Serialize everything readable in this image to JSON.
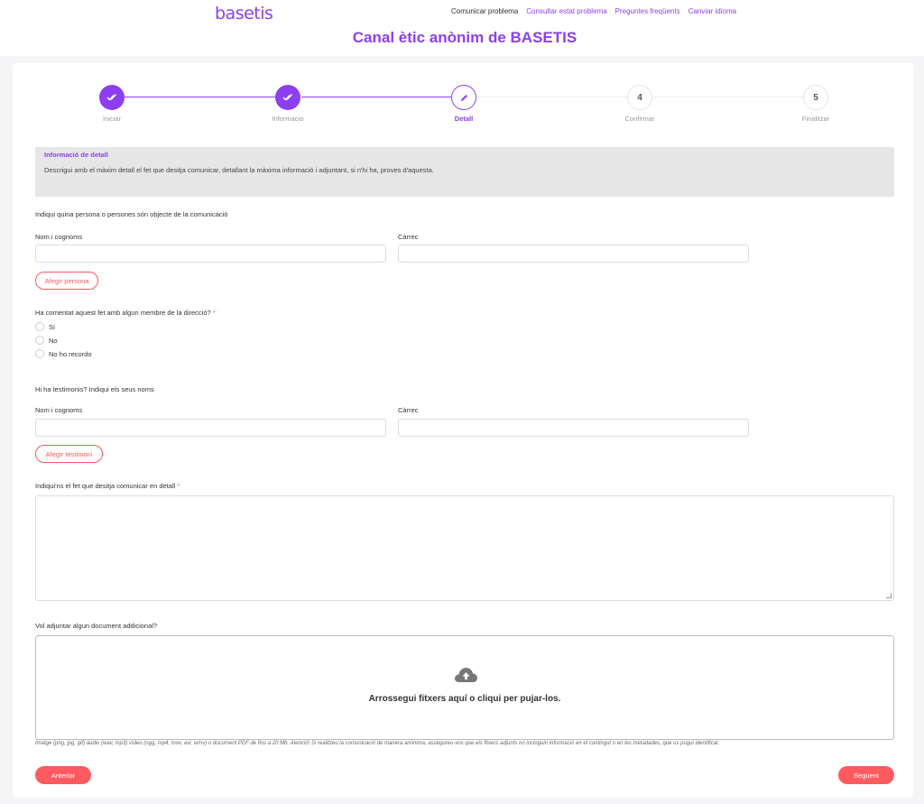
{
  "brand": {
    "logo": "basetis",
    "accent": "#8b3ff0",
    "danger": "#ff5a5f"
  },
  "nav": {
    "items": [
      {
        "label": "Comunicar problema"
      },
      {
        "label": "Consultar estat problema"
      },
      {
        "label": "Preguntes freqüents"
      },
      {
        "label": "Canviar idioma"
      }
    ]
  },
  "page": {
    "title": "Canal ètic anònim de BASETIS"
  },
  "stepper": {
    "steps": [
      {
        "number": "",
        "label": "Iniciar",
        "state": "done",
        "icon": "double-check-icon"
      },
      {
        "number": "",
        "label": "Informació",
        "state": "done",
        "icon": "double-check-icon"
      },
      {
        "number": "",
        "label": "Detall",
        "state": "active",
        "icon": "pencil-icon"
      },
      {
        "number": "4",
        "label": "Confirmar",
        "state": "todo"
      },
      {
        "number": "5",
        "label": "Finalitzar",
        "state": "todo"
      }
    ]
  },
  "info": {
    "title": "Informació de detall",
    "description": "Descrigui amb el màxim detall el fet que desitja comunicar, detallant la màxima informació i adjuntant, si n'hi ha, proves d'aquesta."
  },
  "persons": {
    "heading": "Indiqui quina persona o persones són objecte de la comunicació",
    "name_label": "Nom i cognoms",
    "role_label": "Càrrec",
    "name_value": "",
    "role_value": "",
    "add_button": "Afegir persona"
  },
  "management": {
    "question": "Ha comentat aquest fet amb algun membre de la direcció?",
    "required_mark": "*",
    "options": [
      {
        "label": "Sí"
      },
      {
        "label": "No"
      },
      {
        "label": "No ho recordo"
      }
    ]
  },
  "witnesses": {
    "heading": "Hi ha testimonis? Indiqui els seus noms",
    "name_label": "Nom i cognoms",
    "role_label": "Càrrec",
    "name_value": "",
    "role_value": "",
    "add_button": "Afegir testimoni"
  },
  "detail": {
    "label": "Indiqui'ns el fet que desitja comunicar en detall",
    "required_mark": "*",
    "value": ""
  },
  "attachments": {
    "label": "Vol adjuntar algun document addicional?",
    "dropzone_text": "Arrossegui fitxers aquí o cliqui per pujar-los.",
    "hint": "Imatge (png, jpg, gif) àudio (wav, mp3) vídeo (ogg, mp4, mov, avi, wmv) o document PDF de fins a 20 Mb. Atenció! Si realitzeu la comunicació de manera anònima, assegureu-vos que els fitxers adjunts no incloguin informació en el contingut o en les metadades, que us pugui identificar.",
    "icon": "cloud-upload-icon"
  },
  "footer": {
    "prev_button": "Anterior",
    "next_button": "Següent"
  }
}
